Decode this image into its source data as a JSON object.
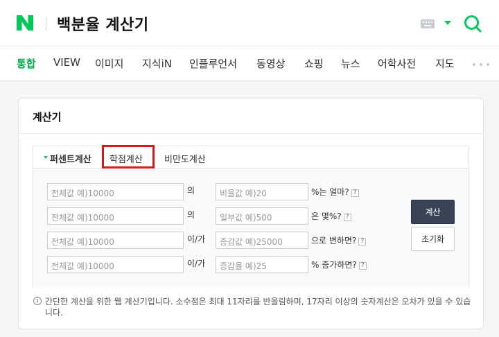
{
  "header": {
    "logo_letter": "N",
    "query": "백분율 계산기",
    "icons": {
      "keyboard": "keyboard-icon",
      "dropdown": "triangle-down-icon",
      "search": "search-icon"
    },
    "brand_color": "#03c75a"
  },
  "nav": {
    "tabs": [
      {
        "label": "통합",
        "active": true
      },
      {
        "label": "VIEW"
      },
      {
        "label": "이미지"
      },
      {
        "label": "지식iN"
      },
      {
        "label": "인플루언서"
      },
      {
        "label": "동영상"
      },
      {
        "label": "쇼핑"
      },
      {
        "label": "뉴스"
      },
      {
        "label": "어학사전"
      },
      {
        "label": "지도"
      }
    ],
    "more_icon": "more-dots-icon"
  },
  "calculator": {
    "title": "계산기",
    "tabs": [
      {
        "label": "퍼센트계산",
        "active": true
      },
      {
        "label": "학점계산",
        "highlighted": true
      },
      {
        "label": "비만도계산"
      }
    ],
    "rows": [
      {
        "total_placeholder": "전체값 예)10000",
        "connector": "의",
        "value_placeholder": "비율값 예)20",
        "suffix": "%는 얼마?"
      },
      {
        "total_placeholder": "전체값 예)10000",
        "connector": "의",
        "value_placeholder": "일부값 예)500",
        "suffix": "은 몇%?"
      },
      {
        "total_placeholder": "전체값 예)10000",
        "connector": "이/가",
        "value_placeholder": "증감값 예)25000",
        "suffix": "으로 변하면?"
      },
      {
        "total_placeholder": "전체값 예)10000",
        "connector": "이/가",
        "value_placeholder": "증감율 예)25",
        "suffix": "% 증가하면?"
      }
    ],
    "help_glyph": "?",
    "calc_button": "계산",
    "reset_button": "초기화",
    "note_icon": "i",
    "note": "간단한 계산을 위한 웹 계산기입니다. 소수점은 최대 11자리를 반올림하며, 17자리 이상의 숫자계산은 오차가 있을 수 있습니다."
  }
}
